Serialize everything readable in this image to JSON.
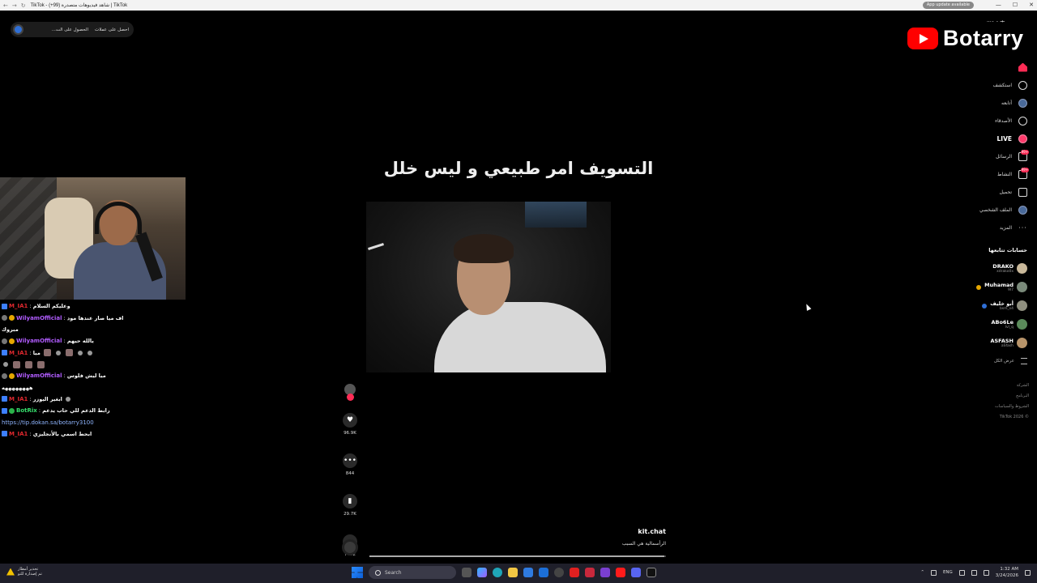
{
  "browser": {
    "tab_title": "TikTok - (+99) شاهد فيديوهات متصدرة | TikTok",
    "update_label": "App update available",
    "win_controls": [
      "—",
      "☐",
      "✕"
    ]
  },
  "top_pill": {
    "item1": "احصل على عملات",
    "item2": "الحصول على الت..."
  },
  "chat": [
    {
      "user": "M_IA1",
      "color": "red",
      "text": "وعليكم السلام"
    },
    {
      "user": "WilyamOfficial",
      "color": "purple",
      "text": "اف ميا صار عندها مود",
      "cont": "مبروك"
    },
    {
      "user": "WilyamOfficial",
      "color": "purple",
      "text": "يالله حيهم"
    },
    {
      "user": "M_IA1",
      "color": "red",
      "text": "ميا"
    },
    {
      "user": "WilyamOfficial",
      "color": "purple",
      "text": "ميا ليش فلوس",
      "cont": "ههههههههه"
    },
    {
      "user": "M_IA1",
      "color": "red",
      "text": "ابغير اليوزر"
    },
    {
      "user": "BotRix",
      "color": "green",
      "text": "رابط الدعم للي حاب يدعم",
      "link": "https://tip.dokan.sa/botarry3100"
    },
    {
      "user": "M_IA1",
      "color": "red",
      "text": "ابحط اسمي بالأنجليزي"
    }
  ],
  "video": {
    "caption": "التسويف امر طبيعي و ليس خلل",
    "author": "kit.chat",
    "description": "الرأسمالية هي السبب",
    "progress": 0.995
  },
  "actions": {
    "likes": "96.9K",
    "comments": "844",
    "saves": "29.7K",
    "shares": "7492"
  },
  "brand": {
    "name": "Botarry",
    "top_mark": "...ـبـ ۔ ۔"
  },
  "nav": {
    "explore": "استكشف",
    "following": "أتابعه",
    "friends": "الأصدقاء",
    "live": "LIVE",
    "messages": "الرسائل",
    "messages_badge": "99+",
    "activity": "النشاط",
    "activity_badge": "99+",
    "upload": "تحميل",
    "profile": "الملف الشخصي",
    "more": "المزيد"
  },
  "following_header": "حسابات تتابعها",
  "following_accounts": [
    {
      "name": "DRAKO",
      "handle": "xdrako0x"
    },
    {
      "name": "Muhamad",
      "handle": "9l7"
    },
    {
      "name": "أبو خليف",
      "handle": "bsm_s4"
    },
    {
      "name": "ABo6Le",
      "handle": "lvl_q"
    },
    {
      "name": "ASFASH",
      "handle": "aSfash"
    }
  ],
  "see_all": "عرض الكل",
  "footer": [
    "الشركة",
    "البرنامج",
    "الشروط والسياسات",
    "TikTok 2026 ©"
  ],
  "taskbar": {
    "weather_line1": "تحذير أمطار",
    "weather_line2": "تم إصدارة للتو",
    "search_placeholder": "Search",
    "lang": "ENG",
    "time": "1:32 AM",
    "date": "3/24/2026"
  }
}
